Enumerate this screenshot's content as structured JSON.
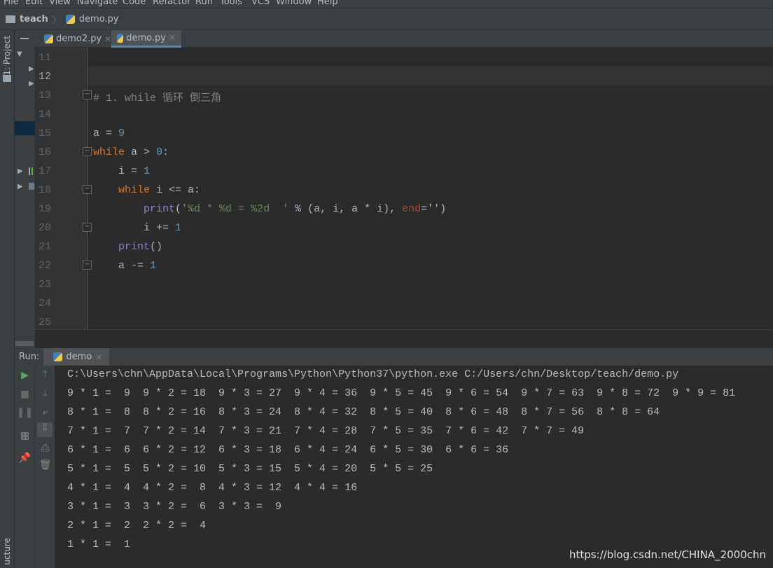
{
  "menu": [
    "File",
    "Edit",
    "View",
    "Navigate",
    "Code",
    "Refactor",
    "Run",
    "Tools",
    "VCS",
    "Window",
    "Help"
  ],
  "breadcrumb": {
    "project": "teach",
    "file": "demo.py"
  },
  "sidebar": {
    "project_label": "1: Project",
    "structure_label": "ucture"
  },
  "tabs": [
    {
      "label": "demo2.py",
      "active": false
    },
    {
      "label": "demo.py",
      "active": true
    }
  ],
  "editor": {
    "current_line": 12,
    "line_numbers": [
      "11",
      "12",
      "13",
      "14",
      "15",
      "16",
      "17",
      "18",
      "19",
      "20",
      "21",
      "22",
      "23",
      "24",
      "25"
    ],
    "lines": {
      "l13": "# 1. while 循环 倒三角",
      "l15_a": "a = ",
      "l15_n": "9",
      "l16_kw": "while",
      "l16_rest": " a > ",
      "l16_n": "0",
      "l16_end": ":",
      "l17_a": "    i = ",
      "l17_n": "1",
      "l18_kw": "    while",
      "l18_rest": " i <= a:",
      "l19_fn": "        print",
      "l19_p": "(",
      "l19_str": "'%d * %d = %2d  '",
      "l19_mid": " % (a, i, a * i), ",
      "l19_kwarg": "end",
      "l19_end": "='')",
      "l20_a": "        i += ",
      "l20_n": "1",
      "l21_fn": "    print",
      "l21_end": "()",
      "l22_a": "    a -= ",
      "l22_n": "1"
    }
  },
  "run": {
    "label": "Run:",
    "tab": "demo",
    "console": [
      "C:\\Users\\chn\\AppData\\Local\\Programs\\Python\\Python37\\python.exe C:/Users/chn/Desktop/teach/demo.py",
      "9 * 1 =  9  9 * 2 = 18  9 * 3 = 27  9 * 4 = 36  9 * 5 = 45  9 * 6 = 54  9 * 7 = 63  9 * 8 = 72  9 * 9 = 81",
      "8 * 1 =  8  8 * 2 = 16  8 * 3 = 24  8 * 4 = 32  8 * 5 = 40  8 * 6 = 48  8 * 7 = 56  8 * 8 = 64",
      "7 * 1 =  7  7 * 2 = 14  7 * 3 = 21  7 * 4 = 28  7 * 5 = 35  7 * 6 = 42  7 * 7 = 49",
      "6 * 1 =  6  6 * 2 = 12  6 * 3 = 18  6 * 4 = 24  6 * 5 = 30  6 * 6 = 36",
      "5 * 1 =  5  5 * 2 = 10  5 * 3 = 15  5 * 4 = 20  5 * 5 = 25",
      "4 * 1 =  4  4 * 2 =  8  4 * 3 = 12  4 * 4 = 16",
      "3 * 1 =  3  3 * 2 =  6  3 * 3 =  9",
      "2 * 1 =  2  2 * 2 =  4",
      "1 * 1 =  1"
    ]
  },
  "watermark": "https://blog.csdn.net/CHINA_2000chn"
}
